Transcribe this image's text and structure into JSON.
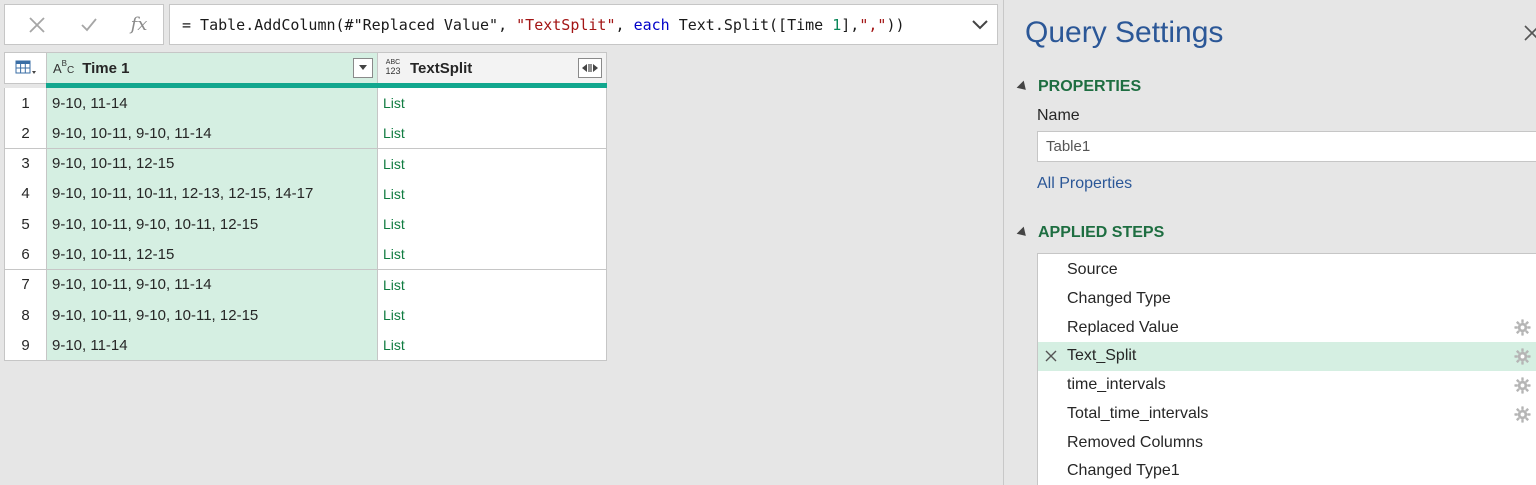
{
  "formula_bar": {
    "fx_label": "fx",
    "formula_tokens": [
      {
        "t": "= Table.AddColumn(#",
        "c": ""
      },
      {
        "t": "\"Replaced Value\"",
        "c": ""
      },
      {
        "t": ", ",
        "c": ""
      },
      {
        "t": "\"TextSplit\"",
        "c": "str"
      },
      {
        "t": ", ",
        "c": ""
      },
      {
        "t": "each",
        "c": "kw"
      },
      {
        "t": " Text.Split([Time ",
        "c": ""
      },
      {
        "t": "1",
        "c": "num"
      },
      {
        "t": "],",
        "c": ""
      },
      {
        "t": "\",\"",
        "c": "str"
      },
      {
        "t": "))",
        "c": ""
      }
    ]
  },
  "grid": {
    "columns": [
      {
        "name": "Time 1",
        "type_icon": "text-type-icon"
      },
      {
        "name": "TextSplit",
        "type_icon": "any-type-icon"
      }
    ],
    "type_abc": "A",
    "type_abc_sup": "B",
    "type_abc_sub": "C",
    "type_any_top": "ABC",
    "type_any_bottom": "123",
    "rows": [
      {
        "num": "1",
        "time": "9-10, 11-14",
        "split": "List"
      },
      {
        "num": "2",
        "time": "9-10, 10-11, 9-10, 11-14",
        "split": "List"
      },
      {
        "num": "3",
        "time": "9-10, 10-11, 12-15",
        "split": "List"
      },
      {
        "num": "4",
        "time": "9-10, 10-11, 10-11, 12-13, 12-15, 14-17",
        "split": "List"
      },
      {
        "num": "5",
        "time": "9-10, 10-11, 9-10, 10-11, 12-15",
        "split": "List"
      },
      {
        "num": "6",
        "time": "9-10, 10-11, 12-15",
        "split": "List"
      },
      {
        "num": "7",
        "time": "9-10, 10-11, 9-10, 11-14",
        "split": "List"
      },
      {
        "num": "8",
        "time": "9-10, 10-11, 9-10, 10-11, 12-15",
        "split": "List"
      },
      {
        "num": "9",
        "time": "9-10, 11-14",
        "split": "List"
      }
    ]
  },
  "query_settings": {
    "title": "Query Settings",
    "properties_heading": "PROPERTIES",
    "name_label": "Name",
    "name_value": "Table1",
    "all_properties_link": "All Properties",
    "applied_steps_heading": "APPLIED STEPS",
    "steps": [
      {
        "label": "Source",
        "gear": false,
        "selected": false
      },
      {
        "label": "Changed Type",
        "gear": false,
        "selected": false
      },
      {
        "label": "Replaced Value",
        "gear": true,
        "selected": false
      },
      {
        "label": "Text_Split",
        "gear": true,
        "selected": true
      },
      {
        "label": "time_intervals",
        "gear": true,
        "selected": false
      },
      {
        "label": "Total_time_intervals",
        "gear": true,
        "selected": false
      },
      {
        "label": "Removed Columns",
        "gear": false,
        "selected": false
      },
      {
        "label": "Changed Type1",
        "gear": false,
        "selected": false
      }
    ]
  },
  "colors": {
    "accent_green": "#12a78e",
    "selected_fill": "#d5efe2",
    "title_blue": "#2b5797",
    "heading_green": "#1e6e41",
    "list_green": "#107c41"
  }
}
